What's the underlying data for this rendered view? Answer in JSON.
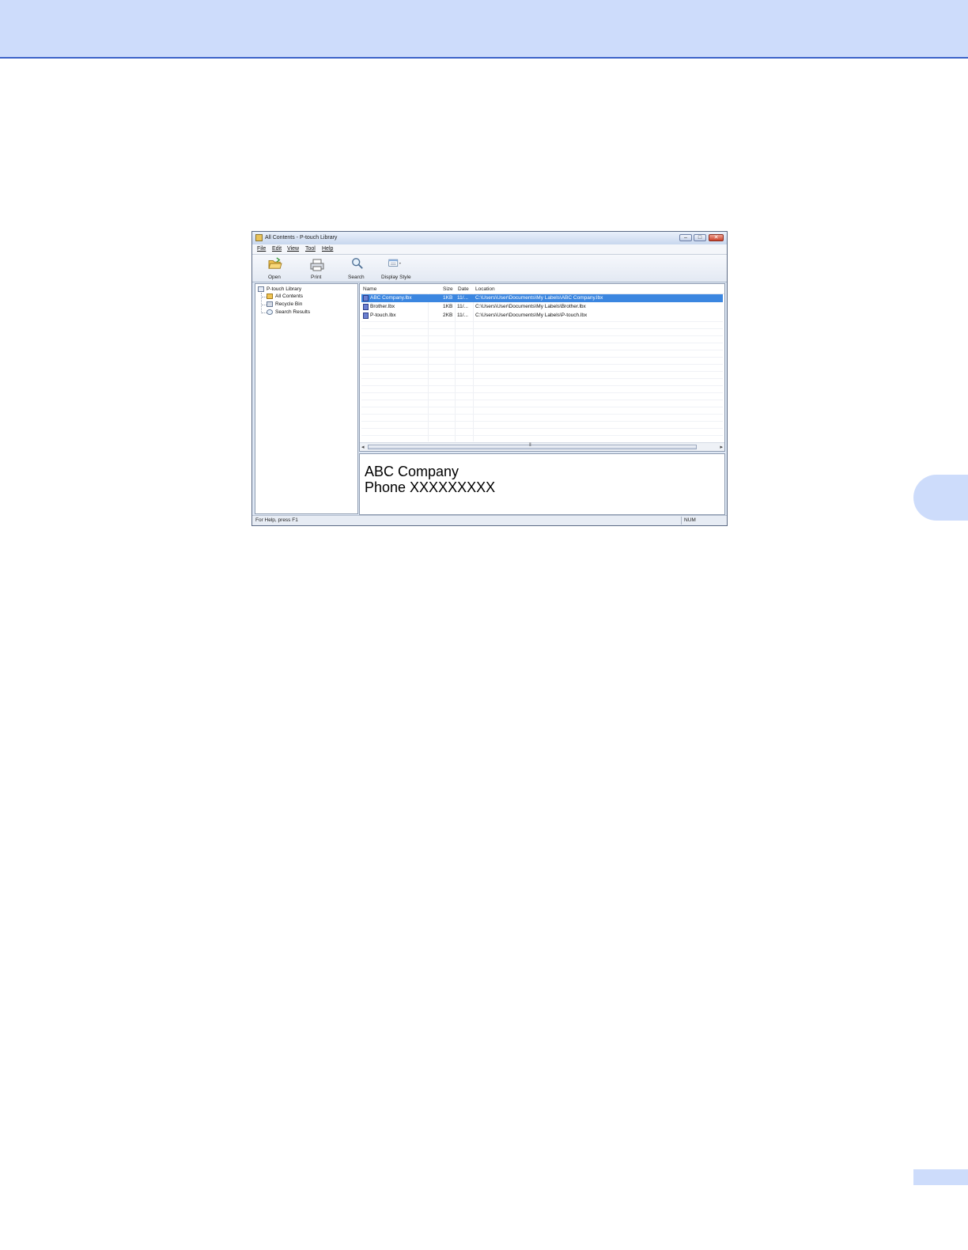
{
  "window": {
    "title": "All Contents - P-touch Library"
  },
  "menu": [
    "File",
    "Edit",
    "View",
    "Tool",
    "Help"
  ],
  "toolbar": {
    "open": "Open",
    "print": "Print",
    "search": "Search",
    "display_style": "Display Style"
  },
  "tree": {
    "root": "P-touch Library",
    "items": [
      "All Contents",
      "Recycle Bin",
      "Search Results"
    ]
  },
  "list": {
    "columns": [
      "Name",
      "Size",
      "Date",
      "Location"
    ],
    "rows": [
      {
        "name": "ABC Company.lbx",
        "size": "1KB",
        "date": "11/...",
        "location": "C:\\Users\\User\\Documents\\My Labels\\ABC Company.lbx",
        "selected": true
      },
      {
        "name": "Brother.lbx",
        "size": "1KB",
        "date": "11/...",
        "location": "C:\\Users\\User\\Documents\\My Labels\\Brother.lbx",
        "selected": false
      },
      {
        "name": "P-touch.lbx",
        "size": "2KB",
        "date": "11/...",
        "location": "C:\\Users\\User\\Documents\\My Labels\\P-touch.lbx",
        "selected": false
      }
    ]
  },
  "preview": {
    "line1": "ABC Company",
    "line2": "Phone XXXXXXXXX"
  },
  "status": {
    "help_text": "For Help, press F1",
    "num": "NUM"
  },
  "colors": {
    "header_band": "#cddcfb",
    "header_rule": "#3c63c8",
    "selection": "#3b86e0"
  }
}
